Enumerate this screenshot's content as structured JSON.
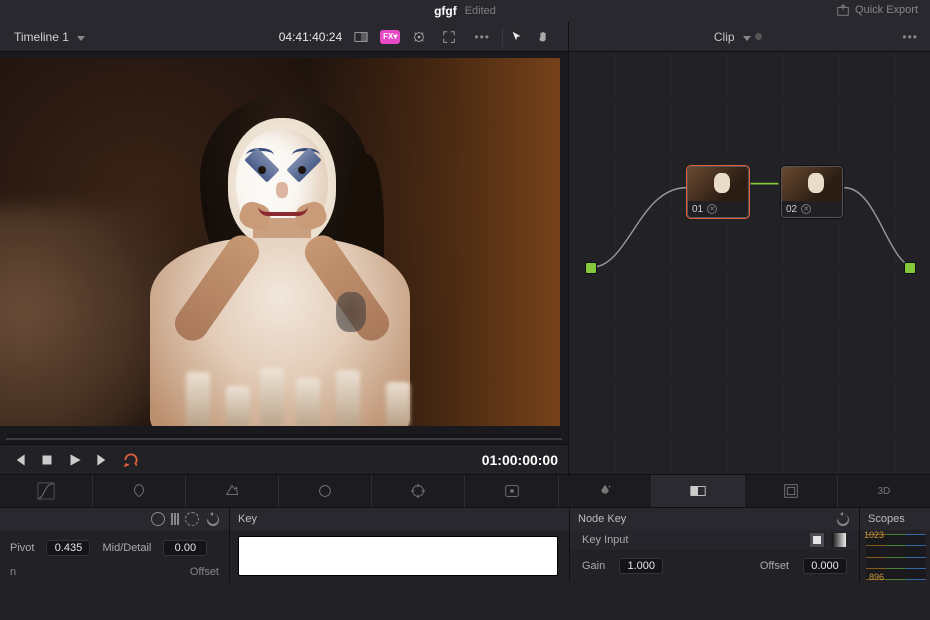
{
  "titlebar": {
    "project": "gfgf",
    "edited": "Edited",
    "quick_export": "Quick Export"
  },
  "secbar": {
    "timeline_name": "Timeline 1",
    "timecode": "04:41:40:24",
    "clip_label": "Clip"
  },
  "transport": {
    "timecode": "01:00:00:00"
  },
  "nodes": [
    {
      "id": "01",
      "selected": true
    },
    {
      "id": "02",
      "selected": false
    }
  ],
  "curves": {
    "pivot_label": "Pivot",
    "pivot_value": "0.435",
    "mid_label": "Mid/Detail",
    "mid_value": "0.00",
    "offset_label": "Offset"
  },
  "key_panel": {
    "title": "Key"
  },
  "key_input": {
    "title": "Key Input",
    "node_key": "Node Key",
    "gain_label": "Gain",
    "gain_value": "1.000",
    "offset_label": "Offset",
    "offset_value": "0.000"
  },
  "scopes": {
    "title": "Scopes",
    "ticks": [
      "1023",
      "896"
    ]
  }
}
